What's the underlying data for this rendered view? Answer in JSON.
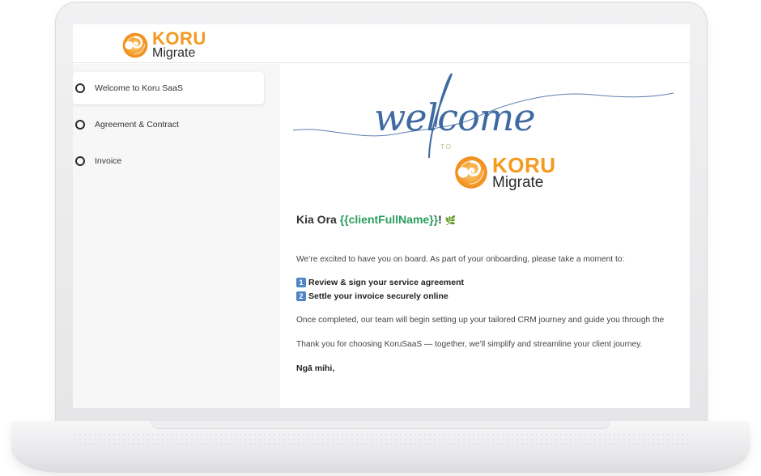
{
  "brand": {
    "name_top": "KORU",
    "name_bottom": "Migrate",
    "orange": "#f39a1f",
    "logo_icon": "koru-swirl-icon"
  },
  "sidebar": {
    "steps": [
      {
        "label": "Welcome to Koru SaaS",
        "active": true
      },
      {
        "label": "Agreement & Contract",
        "active": false
      },
      {
        "label": "Invoice",
        "active": false
      }
    ]
  },
  "content": {
    "hero_script": "welcome",
    "hero_to": "TO",
    "greeting_prefix": "Kia Ora ",
    "greeting_variable": "{{clientFullName}}",
    "greeting_suffix": "!",
    "greeting_icon": "🌿",
    "intro": "We’re excited to have you on board. As part of your onboarding, please take a moment to:",
    "tasks": [
      {
        "number": "1",
        "text": "Review & sign your service agreement"
      },
      {
        "number": "2",
        "text": "Settle your invoice securely online"
      }
    ],
    "completion": "Once completed, our team will begin setting up your tailored CRM journey and guide you through the",
    "thanks": "Thank you for choosing KoruSaaS — together, we’ll simplify and streamline your client journey.",
    "signoff": "Ngā mihi,"
  },
  "colors": {
    "variable_green": "#2a9d5c",
    "script_blue": "#3e6aa1",
    "badge_blue": "#4f86c6"
  }
}
